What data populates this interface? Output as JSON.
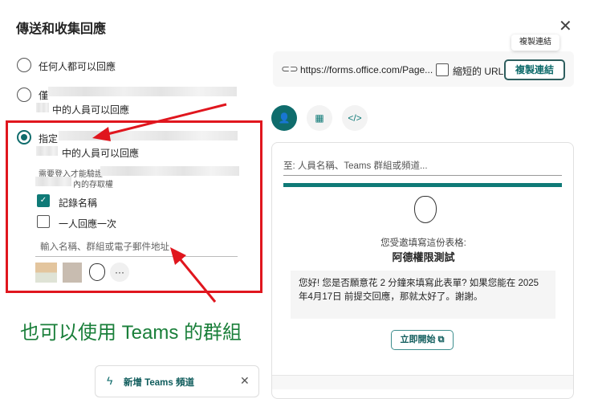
{
  "dialog": {
    "title": "傳送和收集回應",
    "close": "✕"
  },
  "options": {
    "anyone": "任何人都可以回應",
    "only_prefix": "僅",
    "only_suffix": "中的人員可以回應",
    "specific_prefix": "指定",
    "specific_suffix": "中的人員可以回應",
    "login_note_prefix": "需要登入才能驗證",
    "login_note_suffix": "內的存取權",
    "record_name": "記錄名稱",
    "one_response": "一人回應一次",
    "people_placeholder": "輸入名稱、群組或電子郵件地址",
    "more": "···"
  },
  "annotation": "也可以使用 Teams 的群組",
  "teams_card": {
    "label": "新增 Teams 頻道",
    "close": "✕"
  },
  "link": {
    "url": "https://forms.office.com/Page...",
    "shorten": "縮短的 URL",
    "copy": "複製連結",
    "tooltip": "複製連結"
  },
  "invite": {
    "to_placeholder": "至: 人員名稱、Teams 群組或頻道...",
    "invited": "您受邀填寫這份表格:",
    "form_title": "阿德權限測試",
    "message": "您好! 您是否願意花 2 分鐘來填寫此表單? 如果您能在 2025年4月17日 前提交回應，那就太好了。謝謝。",
    "start": "立即開始"
  },
  "colors": {
    "accent": "#0f6c6c",
    "annotation_red": "#e0161e",
    "annotation_green": "#1a7f3a"
  }
}
